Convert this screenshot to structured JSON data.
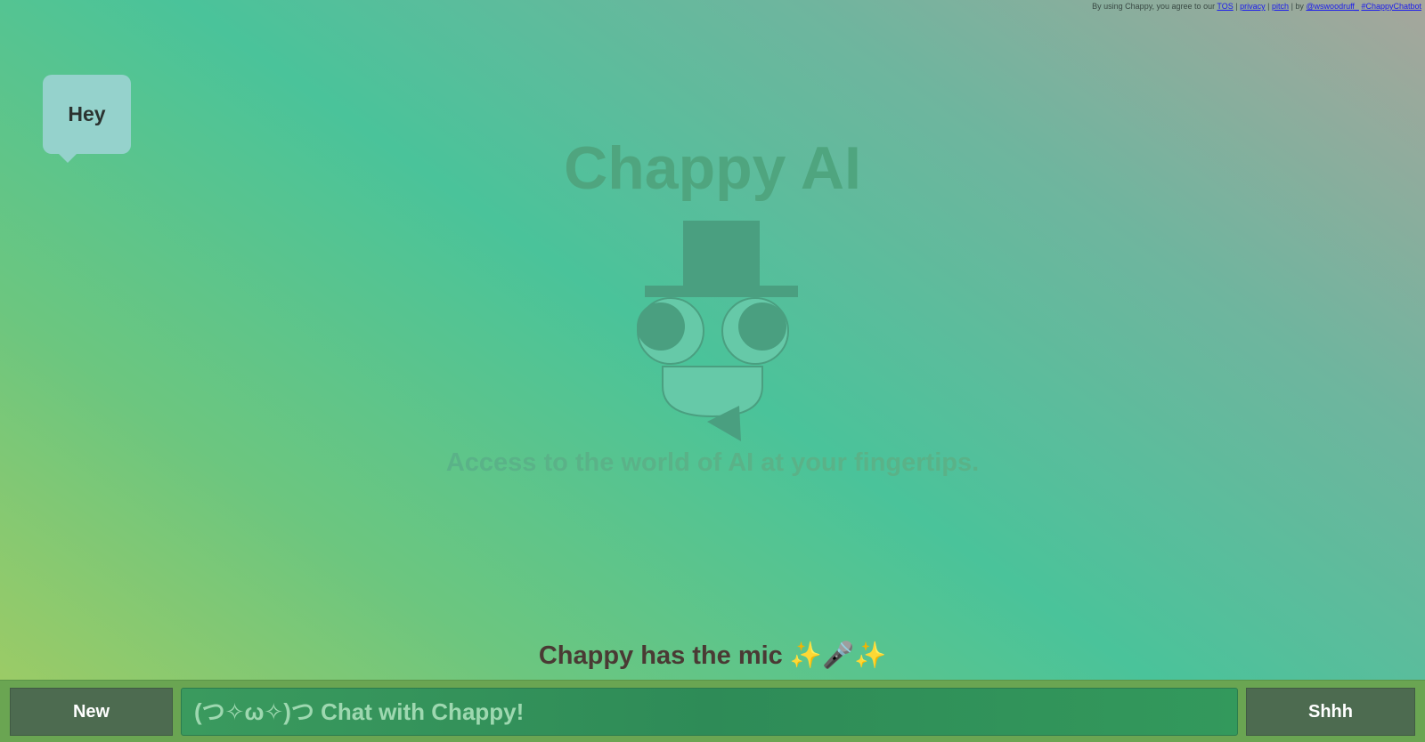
{
  "footer": {
    "prefix": "By using Chappy, you agree to our",
    "tos": "TOS",
    "sep1": "|",
    "privacy": "privacy",
    "sep2": "|",
    "pitch": "pitch",
    "sep3": "| by",
    "author": "@wswoodruff_",
    "hashtag": "#ChappyChatbot"
  },
  "speech_bubble": {
    "text": "Hey"
  },
  "hero": {
    "title": "Chappy AI",
    "tagline": "Access to the world of AI at your fingertips."
  },
  "status": {
    "text": "Chappy has the mic ✨🎤✨"
  },
  "bottom_bar": {
    "new_label": "New",
    "input_placeholder": "(つ✧ω✧)つ Chat with Chappy!",
    "input_value": "",
    "shhh_label": "Shhh"
  },
  "colors": {
    "logo": "#4a9f80",
    "logo_light": "#66c9a8",
    "bar": "#6aa552",
    "button": "#4d6b50",
    "input": "#2e8b57"
  },
  "icons": {
    "logo": "top-hat-robot-logo-icon",
    "sparkles": "sparkles-icon",
    "microphone": "microphone-icon"
  }
}
